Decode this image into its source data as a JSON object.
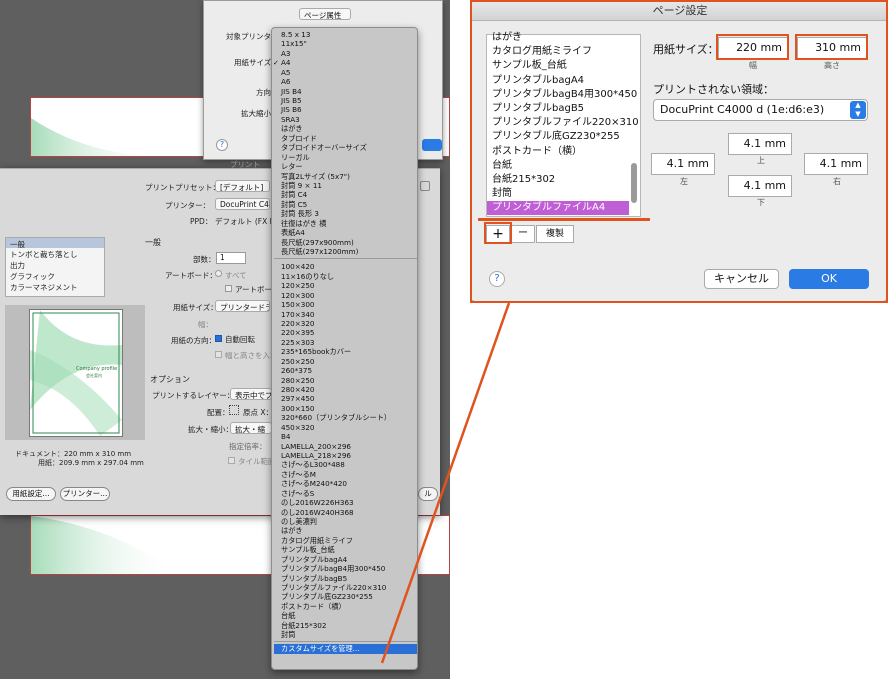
{
  "colors": {
    "accent_orange": "#e0531e",
    "selection_purple": "#c05ed6",
    "menu_highlight": "#2a6fd6",
    "ok_blue": "#2a7be4"
  },
  "page_setup_small": {
    "format_popup": "ページ属性",
    "target_printer_label": "対象プリンタ：",
    "paper_size_label": "用紙サイズ：",
    "direction_label": "方向：",
    "scale_label": "拡大縮小：",
    "help": "?"
  },
  "print_dialog": {
    "section_label": "プリント",
    "preset_label": "プリントプリセット：",
    "preset_value": "[デフォルト]",
    "printer_label": "プリンター：",
    "printer_value": "DocuPrint C400",
    "ppd_label": "PPD：",
    "ppd_value": "デフォルト (FX D",
    "sidebar": [
      "一般",
      "トンボと裁ち落とし",
      "出力",
      "グラフィック",
      "カラーマネジメント"
    ],
    "general_title": "一般",
    "copies_label": "部数：",
    "copies_value": "1",
    "artboard_label": "アートボード：",
    "artboard_all": "すべて",
    "artboard_ignore": "アートボードを",
    "paper_size_label": "用紙サイズ：",
    "paper_size_value": "プリンタードライ",
    "width_label": "幅：",
    "orientation_label": "用紙の方向：",
    "auto_rotate": "自動回転",
    "swap_wh": "幅と高さを入れ",
    "options_title": "オプション",
    "print_layer_label": "プリントするレイヤー：",
    "print_layer_value": "表示中でプ",
    "placement_label": "配置：",
    "origin_label": "原点 X：",
    "scale_label": "拡大・縮小：",
    "scale_value": "拡大・縮",
    "magnification_label": "指定倍率：",
    "tile_label": "タイル範囲",
    "doc_size": "ドキュメント：220 mm x 310 mm",
    "paper_size_info": "用紙：209.9 mm x 297.04 mm",
    "setup_button": "用紙設定...",
    "printer_button": "プリンター...",
    "done_button": "ル",
    "preview_title": "Company profile",
    "preview_sub": "会社案内"
  },
  "menu": {
    "group1": [
      "8.5 x 13",
      "11x15\"",
      "A3",
      "A4",
      "A5",
      "A6",
      "JIS B4",
      "JIS B5",
      "JIS B6",
      "SRA3",
      "はがき",
      "タブロイド",
      "タブロイドオーバーサイズ",
      "リーガル",
      "レター",
      "写真2Lサイズ (5x7\")",
      "封筒 9 × 11",
      "封筒 C4",
      "封筒 C5",
      "封筒 長形 3",
      "往復はがき 横",
      "表紙A4",
      "長尺紙(297x900mm)",
      "長尺紙(297x1200mm)"
    ],
    "checked": "A4",
    "group2": [
      "100×420",
      "11×16のりなし",
      "120×250",
      "120×300",
      "150×300",
      "170×340",
      "220×320",
      "220×395",
      "225×303",
      "235*165bookカバー",
      "250×250",
      "260*375",
      "280×250",
      "280×420",
      "297×450",
      "300×150",
      "320*660（プリンタブルシート）",
      "450×320",
      "B4",
      "LAMELLA_200×296",
      "LAMELLA_218×296",
      "さげ～るL300*488",
      "さげ～るM",
      "さげ～るM240*420",
      "さげ～るS",
      "のし2016W226H363",
      "のし2016W240H368",
      "のし美濃判",
      "はがき",
      "カタログ用紙ミライフ",
      "サンプル板_台紙",
      "プリンタブルbagA4",
      "プリンタブルbagB4用300*450",
      "プリンタブルbagB5",
      "プリンタブルファイル220×310",
      "プリンタブル底GZ230*255",
      "ポストカード（横）",
      "台紙",
      "台紙215*302",
      "封筒"
    ],
    "manage": "カスタムサイズを管理..."
  },
  "mac_dialog": {
    "title": "ページ設定",
    "list": [
      "はがき",
      "カタログ用紙ミライフ",
      "サンプル板_台紙",
      "プリンタブルbagA4",
      "プリンタブルbagB4用300*450",
      "プリンタブルbagB5",
      "プリンタブルファイル220×310",
      "プリンタブル底GZ230*255",
      "ポストカード（横）",
      "台紙",
      "台紙215*302",
      "封筒",
      "プリンタブルファイルA4"
    ],
    "selected": "プリンタブルファイルA4",
    "plus": "+",
    "minus": "ー",
    "duplicate": "複製",
    "paper_size_label": "用紙サイズ：",
    "width_value": "220 mm",
    "width_caption": "幅",
    "height_value": "310 mm",
    "height_caption": "高さ",
    "nonprint_label": "プリントされない領域：",
    "printer_value": "DocuPrint C4000 d (1e:d6:e3)",
    "top_value": "4.1 mm",
    "top_caption": "上",
    "left_value": "4.1 mm",
    "left_caption": "左",
    "right_value": "4.1 mm",
    "right_caption": "右",
    "bottom_value": "4.1 mm",
    "bottom_caption": "下",
    "help": "?",
    "cancel": "キャンセル",
    "ok": "OK"
  }
}
